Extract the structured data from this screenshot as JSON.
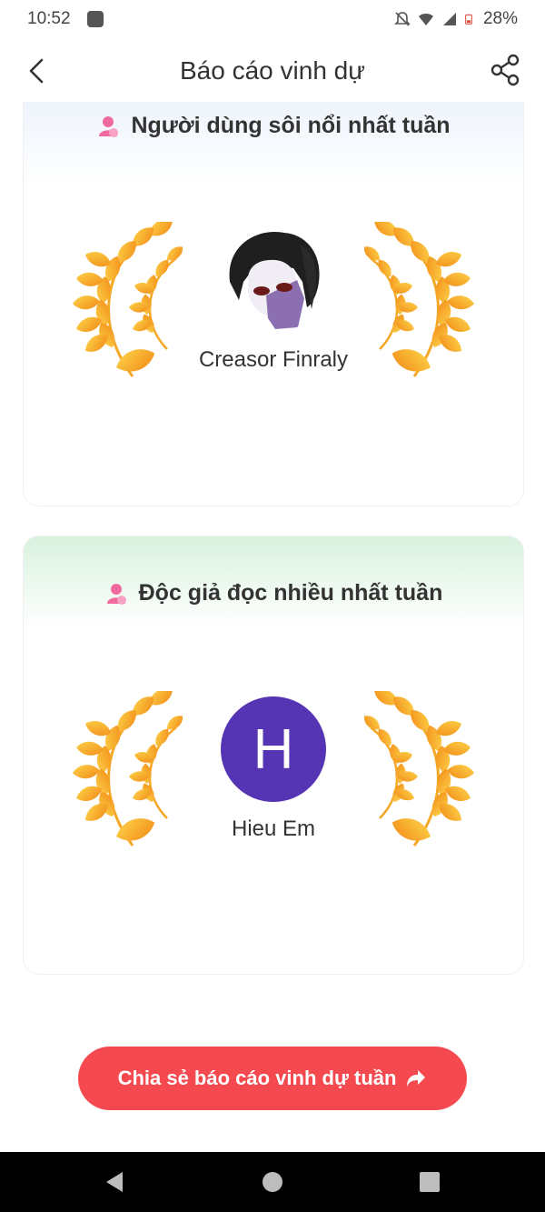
{
  "status_bar": {
    "time": "10:52",
    "battery": "28%",
    "icons": [
      "app-notification-icon",
      "bell-off-icon",
      "wifi-icon",
      "signal-icon",
      "battery-icon"
    ]
  },
  "header": {
    "title": "Báo cáo vinh dự",
    "back_icon": "chevron-left-icon",
    "share_icon": "share-icon"
  },
  "sections": [
    {
      "title": "Người dùng sôi nổi nhất tuần",
      "icon": "person-icon",
      "user": {
        "name": "Creasor Finraly",
        "avatar": "anime-avatar-image"
      }
    },
    {
      "title": "Độc giả đọc nhiều nhất tuần",
      "icon": "person-icon",
      "user": {
        "name": "Hieu Em",
        "avatar_letter": "H",
        "avatar_color": "#5535b3"
      }
    }
  ],
  "share_button": {
    "label": "Chia sẻ báo cáo vinh dự tuần",
    "icon": "share-arrow-icon",
    "color": "#f44a4f"
  },
  "nav": {
    "icons": [
      "back-triangle-icon",
      "home-circle-icon",
      "recents-square-icon"
    ]
  }
}
